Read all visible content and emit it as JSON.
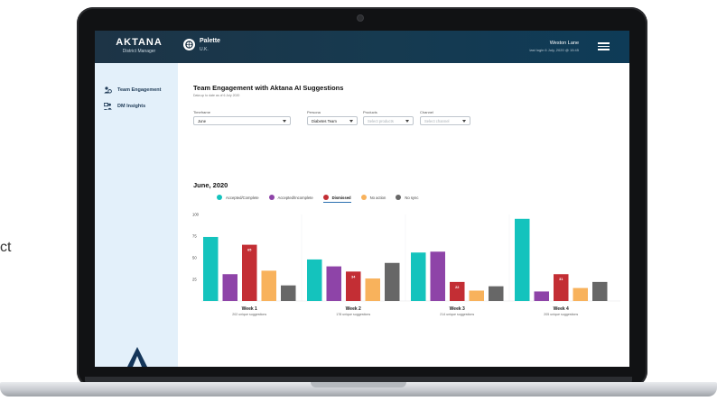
{
  "side_caption": "ct",
  "header": {
    "brand_name": "AKTANA",
    "brand_sub": "District Manager",
    "app_title": "Palette",
    "app_region": "U.K.",
    "user_name": "Weston Lane",
    "last_login": "last login 6 July, 2020 @ 15:45"
  },
  "sidebar": {
    "items": [
      {
        "label": "Team Engagement",
        "icon": "team-icon"
      },
      {
        "label": "DM Insights",
        "icon": "insights-icon"
      }
    ],
    "logo_letter": "A"
  },
  "main": {
    "title": "Team Engagement with Aktana AI Suggestions",
    "subtitle": "Data up to date as of 6 July 2020",
    "filters": {
      "timeframe": {
        "label": "Timeframe",
        "value": "June"
      },
      "persona": {
        "label": "Persona",
        "value": "Diabetes Team"
      },
      "products": {
        "label": "Products",
        "placeholder": "Select products"
      },
      "channel": {
        "label": "Channel",
        "placeholder": "Select channel"
      }
    },
    "period": "June, 2020"
  },
  "chart_data": {
    "type": "bar",
    "categories": [
      "Week 1",
      "Week 2",
      "Week 3",
      "Week 4"
    ],
    "category_subtitles": [
      "202 unique suggestions",
      "178 unique suggestions",
      "214 unique suggestions",
      "205 unique suggestions"
    ],
    "series": [
      {
        "name": "Accepted/Complete",
        "color": "#14c3bd",
        "values": [
          74,
          48,
          56,
          95
        ]
      },
      {
        "name": "Accepted/Incomplete",
        "color": "#8e44a8",
        "values": [
          31,
          40,
          57,
          11
        ]
      },
      {
        "name": "Dismissed",
        "color": "#c32e34",
        "values": [
          65,
          34,
          22,
          31
        ],
        "data_labels": [
          "65",
          "34",
          "22",
          "31"
        ]
      },
      {
        "name": "No action",
        "color": "#f8b25c",
        "values": [
          35,
          26,
          12,
          15
        ]
      },
      {
        "name": "No sync",
        "color": "#676767",
        "values": [
          18,
          44,
          17,
          22
        ]
      }
    ],
    "active_series": "Dismissed",
    "yticks": [
      "25",
      "50",
      "75",
      "100"
    ],
    "ylim": [
      0,
      100
    ],
    "grid": false,
    "legend_position": "top"
  }
}
